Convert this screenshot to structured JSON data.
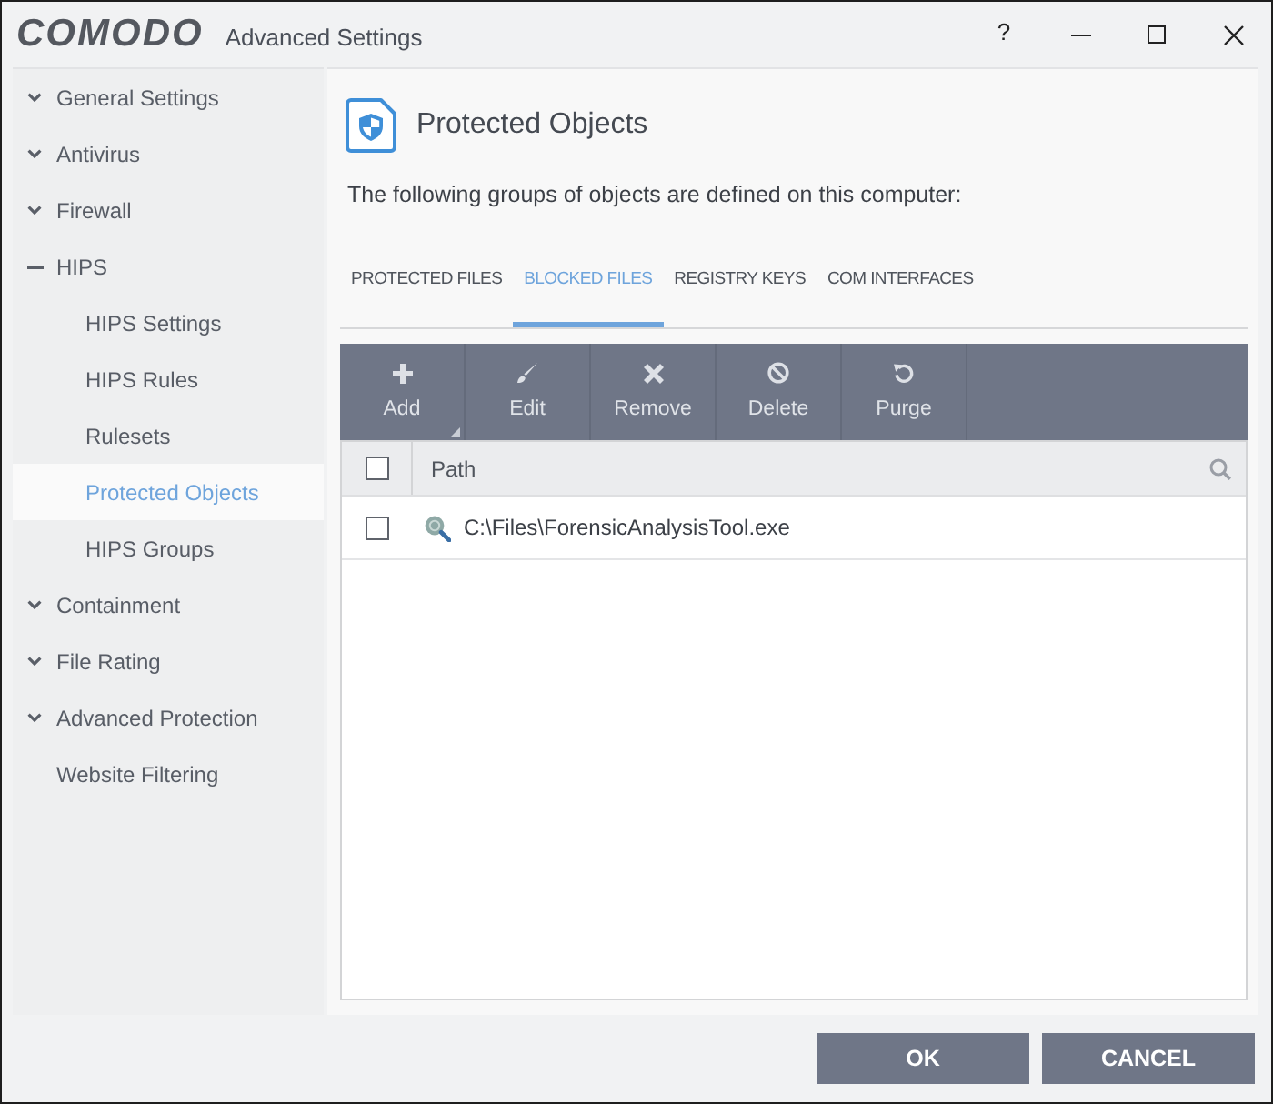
{
  "window": {
    "logo": "COMODO",
    "title": "Advanced Settings",
    "help": "?"
  },
  "sidebar": [
    {
      "label": "General Settings",
      "kind": "group",
      "expanded": false,
      "selected": false
    },
    {
      "label": "Antivirus",
      "kind": "group",
      "expanded": false,
      "selected": false
    },
    {
      "label": "Firewall",
      "kind": "group",
      "expanded": false,
      "selected": false
    },
    {
      "label": "HIPS",
      "kind": "group",
      "expanded": true,
      "selected": false,
      "children": [
        {
          "label": "HIPS Settings",
          "selected": false
        },
        {
          "label": "HIPS Rules",
          "selected": false
        },
        {
          "label": "Rulesets",
          "selected": false
        },
        {
          "label": "Protected Objects",
          "selected": true
        },
        {
          "label": "HIPS Groups",
          "selected": false
        }
      ]
    },
    {
      "label": "Containment",
      "kind": "group",
      "expanded": false,
      "selected": false
    },
    {
      "label": "File Rating",
      "kind": "group",
      "expanded": false,
      "selected": false
    },
    {
      "label": "Advanced Protection",
      "kind": "group",
      "expanded": false,
      "selected": false
    },
    {
      "label": "Website Filtering",
      "kind": "link",
      "selected": false
    }
  ],
  "panel": {
    "title": "Protected Objects",
    "description": "The following groups of objects are defined on this computer:",
    "tabs": [
      {
        "label": "PROTECTED FILES",
        "selected": false
      },
      {
        "label": "BLOCKED FILES",
        "selected": true
      },
      {
        "label": "REGISTRY KEYS",
        "selected": false
      },
      {
        "label": "COM INTERFACES",
        "selected": false
      }
    ],
    "toolbar": [
      {
        "label": "Add",
        "kind": "add",
        "menu": true
      },
      {
        "label": "Edit",
        "kind": "edit",
        "menu": false
      },
      {
        "label": "Remove",
        "kind": "remove",
        "menu": false
      },
      {
        "label": "Delete",
        "kind": "delete",
        "menu": false
      },
      {
        "label": "Purge",
        "kind": "purge",
        "menu": false
      }
    ],
    "table": {
      "select_all_checked": false,
      "columns": [
        "Path"
      ],
      "rows": [
        {
          "path": "C:\\Files\\ForensicAnalysisTool.exe",
          "checked": false,
          "selected": false
        }
      ]
    }
  },
  "footer": {
    "buttons": [
      "OK",
      "CANCEL"
    ]
  }
}
